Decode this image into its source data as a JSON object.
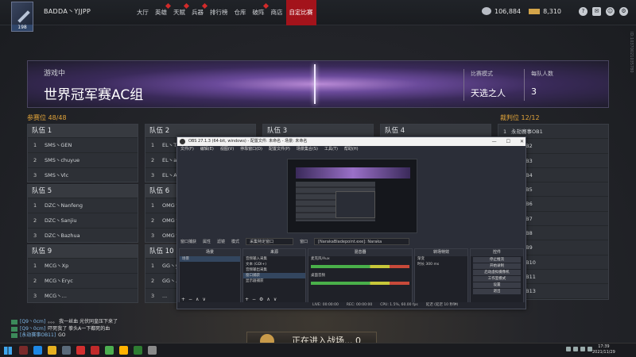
{
  "player": {
    "name": "BADDA丶YJJPP",
    "level": "198"
  },
  "nav": [
    {
      "label": "大厅",
      "dot": false
    },
    {
      "label": "英雄",
      "dot": true
    },
    {
      "label": "天赋",
      "dot": true
    },
    {
      "label": "兵器",
      "dot": true
    },
    {
      "label": "排行榜",
      "dot": false
    },
    {
      "label": "仓库",
      "dot": false
    },
    {
      "label": "破阵",
      "dot": true
    },
    {
      "label": "商店",
      "dot": false
    },
    {
      "label": "自定比赛",
      "dot": false,
      "active": true
    }
  ],
  "currency": {
    "silver": "106,884",
    "gold": "8,310"
  },
  "top_icons": [
    "help-icon",
    "mail-icon",
    "friends-icon",
    "settings-icon"
  ],
  "watermark": "ID:10370021035780",
  "banner": {
    "status": "游戏中",
    "title": "世界冠军赛AC组",
    "mode_label": "比赛模式",
    "mode_value": "天选之人",
    "size_label": "每队人数",
    "size_value": "3"
  },
  "participants_label": "参赛位 48/48",
  "judges_label": "裁判位 12/12",
  "teams": [
    {
      "name": "队伍 1",
      "players": [
        {
          "n": "1",
          "name": "SMS丶GEN"
        },
        {
          "n": "2",
          "name": "SMS丶chuyue"
        },
        {
          "n": "3",
          "name": "SMS丶Vlc"
        }
      ]
    },
    {
      "name": "队伍 2",
      "players": [
        {
          "n": "1",
          "name": "EL丶T..."
        },
        {
          "n": "2",
          "name": "EL丶a..."
        },
        {
          "n": "3",
          "name": "EL丶A..."
        }
      ]
    },
    {
      "name": "队伍 3",
      "players": []
    },
    {
      "name": "队伍 4",
      "players": []
    },
    {
      "name": "队伍 5",
      "players": [
        {
          "n": "1",
          "name": "DZC丶Nanfeng"
        },
        {
          "n": "2",
          "name": "DZC丶Sanjiu"
        },
        {
          "n": "3",
          "name": "DZC丶Bazhua"
        }
      ]
    },
    {
      "name": "队伍 6",
      "players": [
        {
          "n": "1",
          "name": "OMG丶..."
        },
        {
          "n": "2",
          "name": "OMG丶..."
        },
        {
          "n": "3",
          "name": "OMG丶..."
        }
      ]
    },
    {
      "name": "队伍 9",
      "players": [
        {
          "n": "1",
          "name": "MCG丶Xp"
        },
        {
          "n": "2",
          "name": "MCG丶Eryc"
        },
        {
          "n": "3",
          "name": "MCG丶..."
        }
      ]
    },
    {
      "name": "队伍 10",
      "players": [
        {
          "n": "1",
          "name": "GG丶y..."
        },
        {
          "n": "2",
          "name": "GG丶..."
        },
        {
          "n": "3",
          "name": "..."
        }
      ]
    }
  ],
  "judges": [
    {
      "n": "1",
      "name": "永劫赛事OB1"
    },
    {
      "n": "",
      "name": "赛事OB2"
    },
    {
      "n": "",
      "name": "赛事OB3"
    },
    {
      "n": "",
      "name": "赛事OB4"
    },
    {
      "n": "",
      "name": "赛事OB5"
    },
    {
      "n": "",
      "name": "赛事OB6"
    },
    {
      "n": "",
      "name": "赛事OB7"
    },
    {
      "n": "",
      "name": "赛事OB8"
    },
    {
      "n": "",
      "name": "赛事OB9"
    },
    {
      "n": "",
      "name": "赛事OB10"
    },
    {
      "n": "",
      "name": "赛事OB11"
    },
    {
      "n": "",
      "name": "赛事OB13"
    }
  ],
  "obs": {
    "title": "OBS 27.1.3 (64-bit, windows) - 配置文件: 未命名 - 场景: 未命名",
    "controls": [
      "—",
      "☐",
      "✕"
    ],
    "menu": [
      "文件(F)",
      "编辑(E)",
      "视图(V)",
      "停靠窗口(D)",
      "配置文件(P)",
      "场景集合(S)",
      "工具(T)",
      "帮助(H)"
    ],
    "toolbar": {
      "source": "窗口捕获",
      "props": "属性",
      "filters": "滤镜",
      "mode_label": "模式",
      "mode_value": "采集特定窗口",
      "window_label": "窗口",
      "window_value": "[NarakaBladepoint.exe]: Naraka"
    },
    "docks": {
      "scenes": {
        "title": "场景",
        "items": [
          "场景"
        ]
      },
      "sources": {
        "title": "来源",
        "items": [
          "音频输入采集",
          "文本 (GDI+)",
          "音频输出采集",
          "窗口捕获",
          "显示器捕获"
        ]
      },
      "mixer": {
        "title": "混音器",
        "items": [
          "麦克风/Aux",
          "桌面音频"
        ]
      },
      "transitions": {
        "title": "转场特效",
        "items": [
          "渐变",
          "时长 300 ms"
        ]
      },
      "controls": {
        "title": "控件",
        "items": [
          "停止推流",
          "开始录制",
          "启动虚拟摄像机",
          "工作室模式",
          "设置",
          "退出"
        ]
      }
    },
    "status": [
      "LIVE: 00:00:00",
      "REC: 00:00:00",
      "CPU: 1.5%, 60.00 fps",
      "延迟 (延迟 10 秒钟)"
    ]
  },
  "chat": [
    {
      "user": "[Q9丶0cm]",
      "msg": "。。。 我一丝血 光伏同皇压下来了"
    },
    {
      "user": "[Q9丶0cm]",
      "msg": "吓死我了 拳头A一下都死的血"
    },
    {
      "user": "[永劫赛事OB11]",
      "msg": "GO"
    }
  ],
  "entering_text": "正在进入战场... 0",
  "taskbar": {
    "apps": [
      "#7a2a2a",
      "#1e88e5",
      "#e6b020",
      "#5a6a7a",
      "#d32f2f",
      "#c02a2a",
      "#4caf50",
      "#ffb300",
      "#2e7d32",
      "#8a8a8a"
    ],
    "time": "17:39",
    "date": "2021/11/29"
  }
}
